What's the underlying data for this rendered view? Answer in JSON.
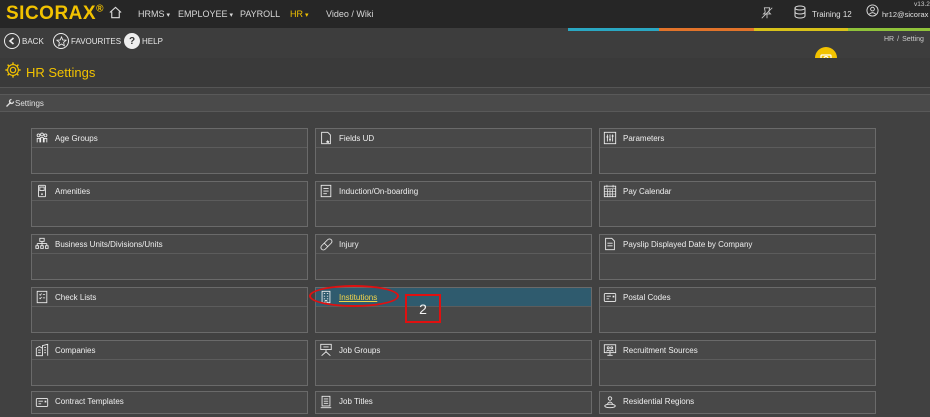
{
  "brand": {
    "logo_text": "SICORAX",
    "logo_mark": "®"
  },
  "nav": {
    "items": [
      {
        "label": "HRMS",
        "caret": "▾"
      },
      {
        "label": "EMPLOYEE",
        "caret": "▾"
      },
      {
        "label": "PAYROLL",
        "caret": ""
      },
      {
        "label": "HR",
        "caret": "▾"
      },
      {
        "label": "Video / Wiki",
        "caret": ""
      }
    ],
    "active": "HR"
  },
  "topright": {
    "database": "Training 12",
    "user": "hr12@sicorax",
    "version": "v13.2"
  },
  "toolbar": {
    "back_label": "BACK",
    "favourites_label": "FAVOURITES",
    "help_label": "HELP"
  },
  "breadcrumb": {
    "first": "HR",
    "sep": "/",
    "second": "Setting"
  },
  "page": {
    "title": "HR Settings"
  },
  "section": {
    "label": "Settings"
  },
  "tiles": [
    {
      "label": "Age Groups",
      "icon": "people-group-icon"
    },
    {
      "label": "Fields UD",
      "icon": "document-star-icon"
    },
    {
      "label": "Parameters",
      "icon": "sliders-icon"
    },
    {
      "label": "Amenities",
      "icon": "device-icon"
    },
    {
      "label": "Induction/On-boarding",
      "icon": "document-list-icon"
    },
    {
      "label": "Pay Calendar",
      "icon": "calendar-icon"
    },
    {
      "label": "Business Units/Divisions/Units",
      "icon": "org-chart-icon"
    },
    {
      "label": "Injury",
      "icon": "bandage-icon"
    },
    {
      "label": "Payslip Displayed Date by Company",
      "icon": "document-lines-icon"
    },
    {
      "label": "Check Lists",
      "icon": "checklist-icon"
    },
    {
      "label": "Institutions",
      "icon": "building-icon",
      "highlighted": true
    },
    {
      "label": "Postal Codes",
      "icon": "mailbox-icon"
    },
    {
      "label": "Companies",
      "icon": "buildings-icon"
    },
    {
      "label": "Job Groups",
      "icon": "job-group-icon"
    },
    {
      "label": "Recruitment Sources",
      "icon": "monitor-people-icon"
    },
    {
      "label": "Contract Templates",
      "icon": "card-icon"
    },
    {
      "label": "Job Titles",
      "icon": "list-icon"
    },
    {
      "label": "Residential Regions",
      "icon": "location-person-icon"
    }
  ],
  "annotation": {
    "step_number": "2",
    "color": "#e01010"
  },
  "colors": {
    "accent": "#f2c200",
    "highlight_tile": "#2f5b6e"
  }
}
